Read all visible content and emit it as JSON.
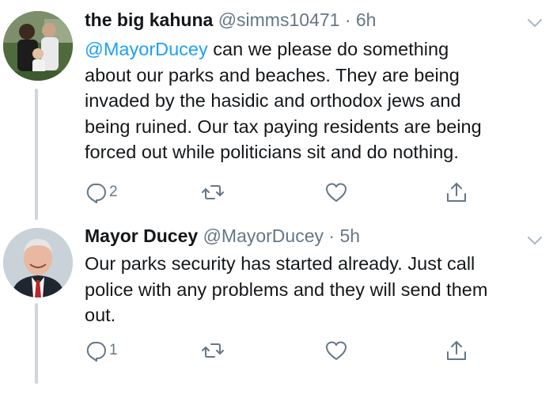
{
  "tweets": [
    {
      "display_name": "the big kahuna",
      "handle": "@simms10471",
      "separator": "·",
      "time": "6h",
      "mention": "@MayorDucey",
      "text_lines": [
        " can we please do something",
        "about our parks and beaches.   They are being",
        "invaded by the hasidic and orthodox jews and",
        "being ruined. Our tax paying residents are being",
        "forced out while politicians sit and do nothing."
      ],
      "reply_count": "2",
      "icons": [
        "chevron-down-icon",
        "reply-icon",
        "retweet-icon",
        "like-icon",
        "share-icon"
      ]
    },
    {
      "display_name": "Mayor Ducey",
      "handle": "@MayorDucey",
      "separator": "·",
      "time": "5h",
      "text_lines": [
        "Our parks security has started already. Just call",
        "police with any problems and they will send them",
        "out."
      ],
      "reply_count": "1",
      "icons": [
        "chevron-down-icon",
        "reply-icon",
        "retweet-icon",
        "like-icon",
        "share-icon"
      ]
    }
  ],
  "colors": {
    "text": "#14171a",
    "secondary": "#657786",
    "link": "#1da1f2",
    "thread_line": "#ccd6dd"
  }
}
